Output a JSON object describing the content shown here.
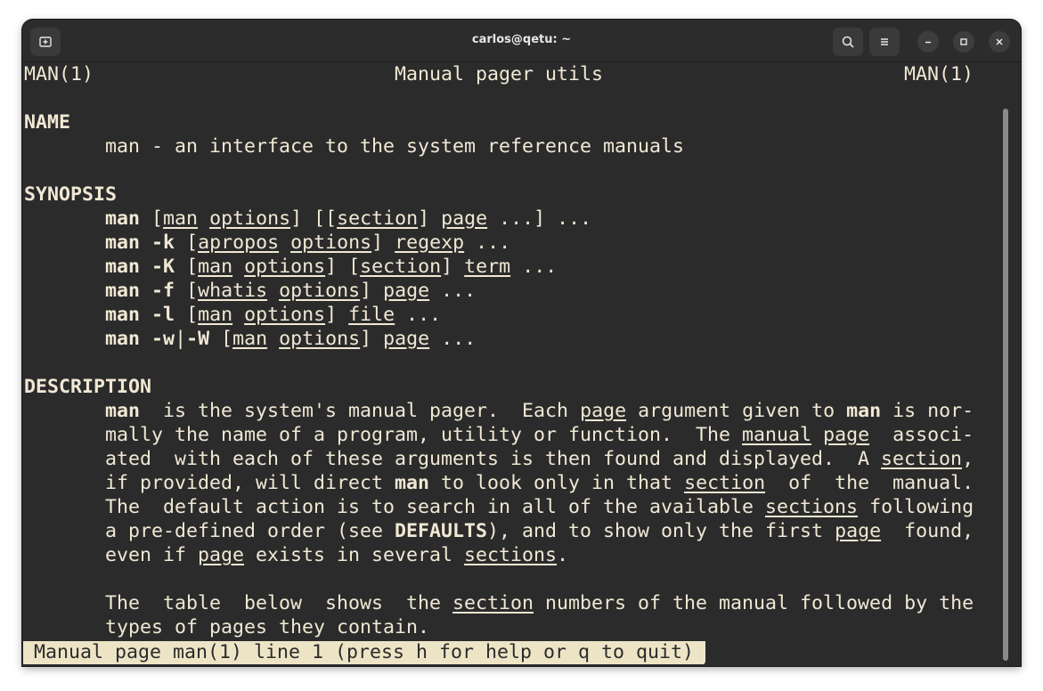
{
  "window": {
    "title": "carlos@qetu: ~"
  },
  "icons": {
    "new_tab": "new-tab-icon",
    "search": "search-icon",
    "menu": "hamburger-menu-icon",
    "minimize": "minimize-icon",
    "maximize": "maximize-icon",
    "close": "close-icon"
  },
  "colors": {
    "terminal_bg": "#2b2b2b",
    "terminal_fg": "#f0e8d4",
    "status_bg": "#ede4c6"
  },
  "man": {
    "header_left": "MAN(1)",
    "header_center": "Manual pager utils",
    "header_right": "MAN(1)",
    "name_heading": "NAME",
    "name_line": "man - an interface to the system reference manuals",
    "synopsis_heading": "SYNOPSIS",
    "description_heading": "DESCRIPTION",
    "status": "Manual page man(1) line 1 (press h for help or q to quit)"
  }
}
